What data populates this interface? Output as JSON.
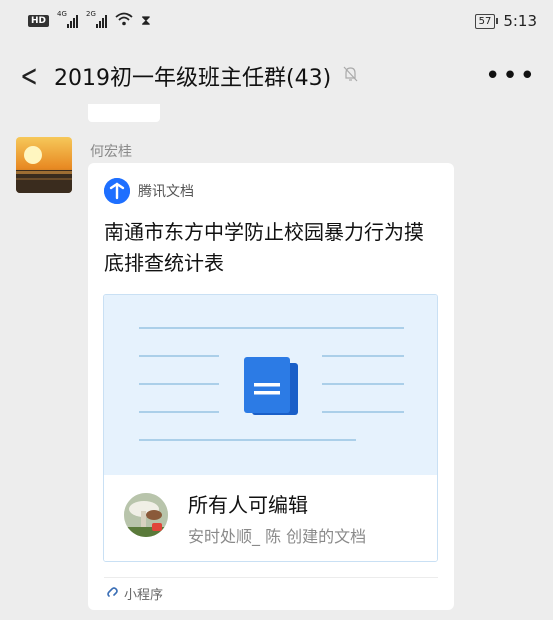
{
  "status_bar": {
    "hd": "HD",
    "signal1_type": "4G",
    "signal2_type": "2G",
    "battery": "57",
    "time": "5:13"
  },
  "nav": {
    "title": "2019初一年级班主任群(43)"
  },
  "message": {
    "sender": "何宏桂",
    "card": {
      "brand": "腾讯文档",
      "title": "南通市东方中学防止校园暴力行为摸底排查统计表",
      "permission": "所有人可编辑",
      "creator": "安时处顺_ 陈 创建的文档",
      "footer": "小程序"
    }
  },
  "colors": {
    "background": "#ededed",
    "brand_blue": "#1e6fff",
    "doc_blue": "#2c7be5",
    "preview_bg": "#e6f2fd"
  }
}
